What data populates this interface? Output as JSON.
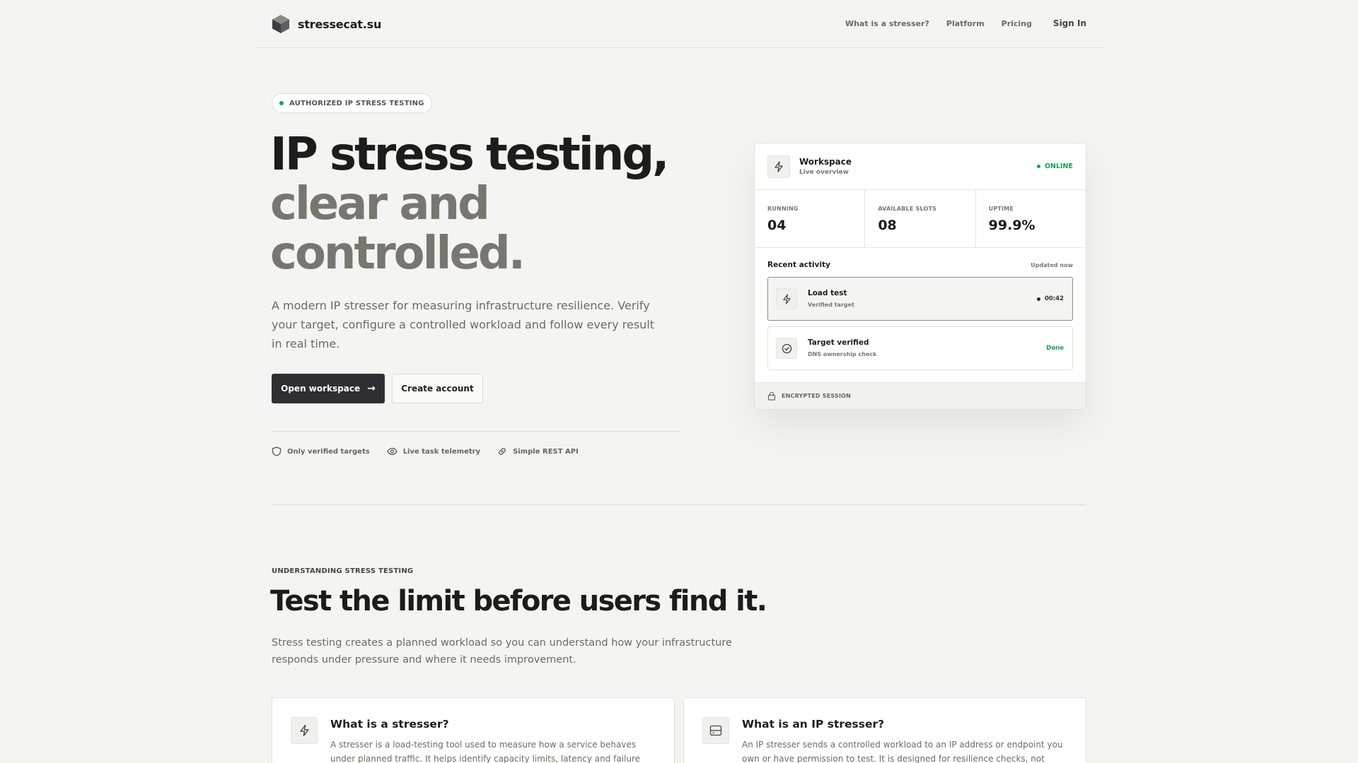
{
  "nav": {
    "brand": "stressecat.su",
    "links": [
      "What is a stresser?",
      "Platform",
      "Pricing"
    ],
    "signin": "Sign In"
  },
  "hero": {
    "badge": "AUTHORIZED IP STRESS TESTING",
    "title_line1": "IP stress testing,",
    "title_line2": "clear and",
    "title_line3": "controlled.",
    "lead": "A modern IP stresser for measuring infrastructure resilience. Verify your target, configure a controlled workload and follow every result in real time.",
    "primary_button": "Open workspace",
    "secondary_button": "Create account",
    "features": [
      {
        "label": "Only verified targets",
        "icon": "shield-icon"
      },
      {
        "label": "Live task telemetry",
        "icon": "eye-icon"
      },
      {
        "label": "Simple REST API",
        "icon": "link-icon"
      }
    ]
  },
  "dashboard": {
    "title": "Workspace",
    "subtitle": "Live overview",
    "status": "ONLINE",
    "stats": [
      {
        "label": "RUNNING",
        "value": "04"
      },
      {
        "label": "AVAILABLE SLOTS",
        "value": "08"
      },
      {
        "label": "UPTIME",
        "value": "99.9%"
      }
    ],
    "recent_title": "Recent activity",
    "recent_updated": "Updated now",
    "activity": [
      {
        "title": "Load test",
        "subtitle": "Verified target",
        "right": "00:42",
        "icon": "bolt-icon"
      },
      {
        "title": "Target verified",
        "subtitle": "DNS ownership check",
        "right": "Done",
        "icon": "check-circle-icon"
      }
    ],
    "footer": "ENCRYPTED SESSION"
  },
  "section": {
    "eyebrow": "UNDERSTANDING STRESS TESTING",
    "title": "Test the limit before users find it.",
    "lead": "Stress testing creates a planned workload so you can understand how your infrastructure responds under pressure and where it needs improvement.",
    "cards": [
      {
        "title": "What is a stresser?",
        "body": "A stresser is a load-testing tool used to measure how a service behaves under planned traffic. It helps identify capacity limits, latency and failure",
        "icon": "bolt-icon"
      },
      {
        "title": "What is an IP stresser?",
        "body": "An IP stresser sends a controlled workload to an IP address or endpoint you own or have permission to test. It is designed for resilience checks, not",
        "icon": "server-icon"
      }
    ]
  },
  "colors": {
    "accent_green": "#1f9d55",
    "dark": "#2f2f33",
    "muted_title": "#78776f",
    "background": "#f4f4f2"
  }
}
